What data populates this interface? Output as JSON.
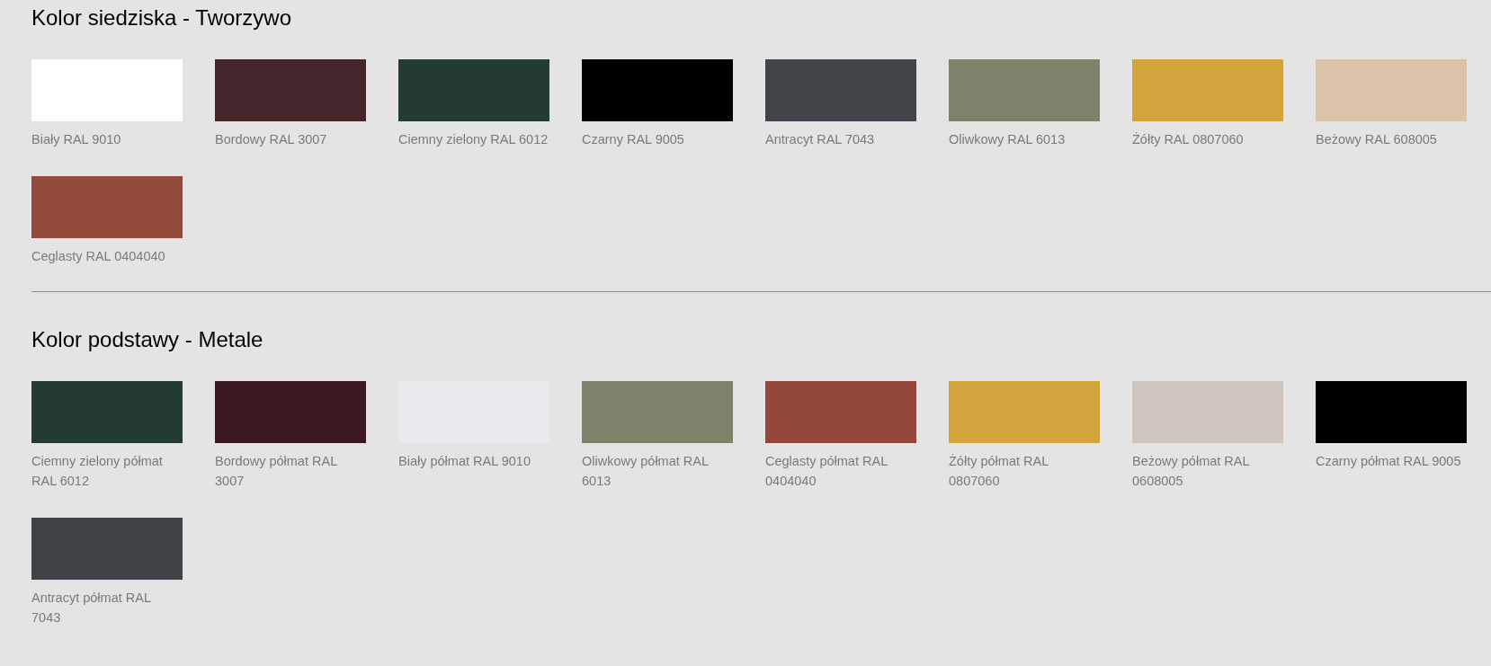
{
  "sections": [
    {
      "title": "Kolor siedziska - Tworzywo",
      "swatches": [
        {
          "label": "Biały RAL 9010",
          "color": "#ffffff"
        },
        {
          "label": "Bordowy RAL 3007",
          "color": "#45262a"
        },
        {
          "label": "Ciemny zielony RAL 6012",
          "color": "#233a35"
        },
        {
          "label": "Czarny RAL 9005",
          "color": "#000000"
        },
        {
          "label": "Antracyt RAL 7043",
          "color": "#414449"
        },
        {
          "label": "Oliwkowy RAL 6013",
          "color": "#7e826a"
        },
        {
          "label": "Żółty RAL 0807060",
          "color": "#d4a43c"
        },
        {
          "label": "Beżowy RAL 608005",
          "color": "#dbc3a8"
        },
        {
          "label": "Ceglasty RAL 0404040",
          "color": "#93493c"
        }
      ]
    },
    {
      "title": "Kolor podstawy - Metale",
      "swatches": [
        {
          "label": "Ciemny zielony półmat RAL 6012",
          "color": "#233a35"
        },
        {
          "label": "Bordowy półmat RAL 3007",
          "color": "#3c1820"
        },
        {
          "label": "Biały półmat RAL 9010",
          "color": "#e9eaee"
        },
        {
          "label": "Oliwkowy półmat RAL 6013",
          "color": "#7e826a"
        },
        {
          "label": "Ceglasty półmat RAL 0404040",
          "color": "#93463a"
        },
        {
          "label": "Żółty półmat RAL 0807060",
          "color": "#d2a43c"
        },
        {
          "label": "Beżowy półmat RAL 0608005",
          "color": "#d0c4be"
        },
        {
          "label": "Czarny półmat RAL 9005",
          "color": "#000000"
        },
        {
          "label": "Antracyt półmat RAL 7043",
          "color": "#3f4347"
        }
      ]
    }
  ]
}
